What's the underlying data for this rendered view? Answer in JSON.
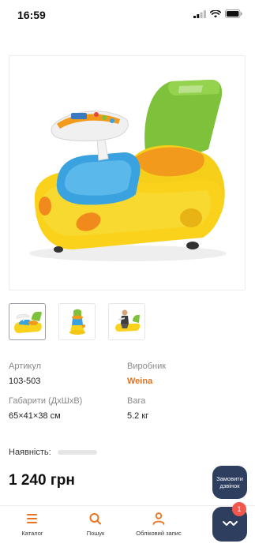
{
  "status_bar": {
    "time": "16:59"
  },
  "product": {
    "image_alt": "children ride-on car toy, yellow with blue and green",
    "thumbnail_count": 3,
    "active_thumbnail": 1
  },
  "specs": {
    "article_label": "Артикул",
    "article_value": "103-503",
    "manufacturer_label": "Виробник",
    "manufacturer_value": "Weina",
    "dimensions_label": "Габарити (ДхШхВ)",
    "dimensions_value": "65×41×38 см",
    "weight_label": "Вага",
    "weight_value": "5.2 кг"
  },
  "availability": {
    "label": "Наявність:"
  },
  "price": {
    "value": "1 240 грн"
  },
  "callback": {
    "label": "Замовити дзвінок"
  },
  "nav": {
    "items": [
      {
        "label": "Каталог",
        "icon": "menu-icon"
      },
      {
        "label": "Пошук",
        "icon": "search-icon"
      },
      {
        "label": "Обліковий запис",
        "icon": "user-icon"
      }
    ]
  },
  "chat": {
    "badge_count": "1",
    "icon": "chat-face-icon"
  },
  "colors": {
    "accent": "#e8731e",
    "navy": "#2d3e5e",
    "badge": "#f0584f"
  }
}
